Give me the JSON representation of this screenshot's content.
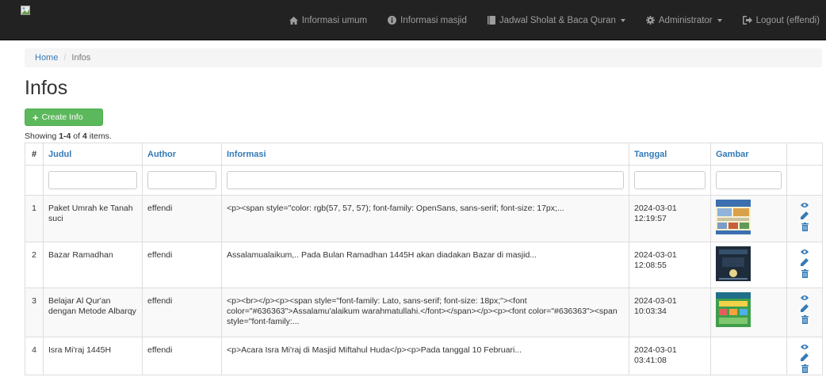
{
  "navbar": {
    "brand_image": "broken-image-icon",
    "items": [
      {
        "label": "Informasi umum",
        "icon": "home-icon"
      },
      {
        "label": "Informasi masjid",
        "icon": "info-circle-icon"
      },
      {
        "label": "Jadwal Sholat & Baca Quran",
        "icon": "book-icon",
        "dropdown": true
      },
      {
        "label": "Administrator",
        "icon": "gear-icon",
        "dropdown": true
      },
      {
        "label": "Logout (effendi)",
        "icon": "logout-icon"
      }
    ]
  },
  "breadcrumb": {
    "home": "Home",
    "separator": "/",
    "current": "Infos"
  },
  "page": {
    "title": "Infos"
  },
  "toolbar": {
    "create_label": "Create Info"
  },
  "summary": {
    "prefix": "Showing ",
    "range": "1-4",
    "middle": " of ",
    "total": "4",
    "suffix": " items."
  },
  "table": {
    "columns": [
      "#",
      "Judul",
      "Author",
      "Informasi",
      "Tanggal",
      "Gambar",
      ""
    ],
    "rows": [
      {
        "num": "1",
        "judul": "Paket Umrah ke Tanah suci",
        "author": "effendi",
        "informasi": "<p><span style=\"color: rgb(57, 57, 57); font-family: OpenSans, sans-serif; font-size: 17px;...",
        "tanggal": "2024-03-01 12:19:57",
        "gambar": "poster-umrah",
        "has_image": true
      },
      {
        "num": "2",
        "judul": "Bazar Ramadhan",
        "author": "effendi",
        "informasi": "Assalamualaikum,.. Pada Bulan Ramadhan 1445H akan diadakan Bazar di masjid...",
        "tanggal": "2024-03-01 12:08:55",
        "gambar": "poster-bazar",
        "has_image": true
      },
      {
        "num": "3",
        "judul": "Belajar Al Qur'an dengan Metode Albarqy",
        "author": "effendi",
        "informasi": "<p><br></p><p><span style=\"font-family: Lato, sans-serif; font-size: 18px;\"><font color=\"#636363\">Assalamu'alaikum warahmatullahi.</font></span></p><p><font color=\"#636363\"><span style=\"font-family:...",
        "tanggal": "2024-03-01 10:03:34",
        "gambar": "poster-albarqy",
        "has_image": true
      },
      {
        "num": "4",
        "judul": "Isra Mi'raj 1445H",
        "author": "effendi",
        "informasi": "<p>Acara Isra Mi'raj di Masjid Miftahul Huda</p><p>Pada tanggal 10 Februari...",
        "tanggal": "2024-03-01 03:41:08",
        "gambar": "",
        "has_image": false
      }
    ],
    "row_actions": [
      "eye-icon",
      "pencil-icon",
      "trash-icon"
    ]
  },
  "colors": {
    "navbar_bg": "#222222",
    "nav_text": "#9d9d9d",
    "link": "#337ab7",
    "success": "#5cb85c",
    "stripe": "#f9f9f9",
    "border": "#dddddd"
  }
}
